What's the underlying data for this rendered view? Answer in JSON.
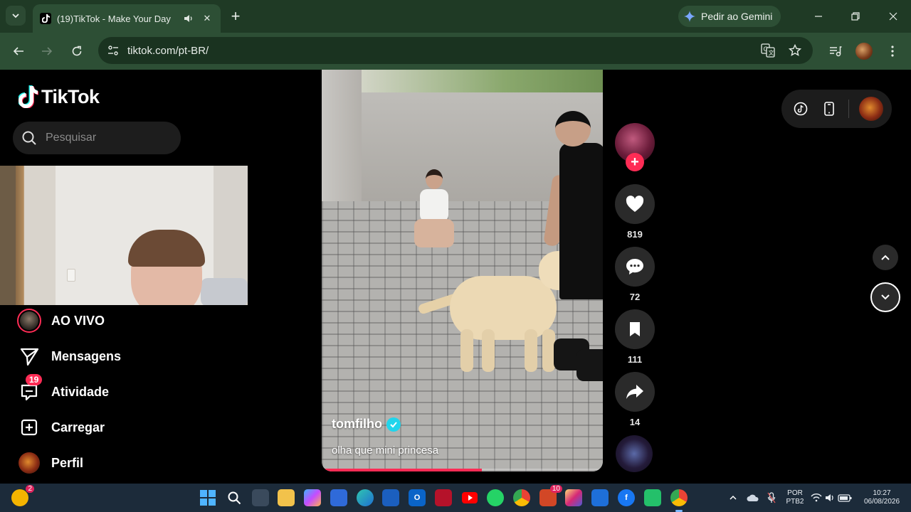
{
  "browser": {
    "tab_title": "(19)TikTok - Make Your Day",
    "gemini_label": "Pedir ao Gemini",
    "url": "tiktok.com/pt-BR/"
  },
  "sidebar": {
    "logo": "TikTok",
    "search_placeholder": "Pesquisar",
    "items": [
      {
        "label": "AO VIVO",
        "icon": "live-avatar-icon"
      },
      {
        "label": "Mensagens",
        "icon": "send-icon"
      },
      {
        "label": "Atividade",
        "icon": "activity-icon",
        "badge": "19"
      },
      {
        "label": "Carregar",
        "icon": "upload-icon"
      },
      {
        "label": "Perfil",
        "icon": "profile-avatar-icon"
      }
    ]
  },
  "video": {
    "username": "tomfilho",
    "caption": "olha que mini princesa",
    "progress": 0.57
  },
  "actions": {
    "likes": "819",
    "comments": "72",
    "saves": "111",
    "shares": "14"
  },
  "taskbar": {
    "widget_badge": "2",
    "outlook_badge": "10",
    "lang_line1": "POR",
    "lang_line2": "PTB2",
    "time": "10:27",
    "date": "06/08/2026"
  },
  "colors": {
    "accent": "#fe2c55",
    "verified": "#20d5ec",
    "chrome_bg": "#2d4f35"
  }
}
